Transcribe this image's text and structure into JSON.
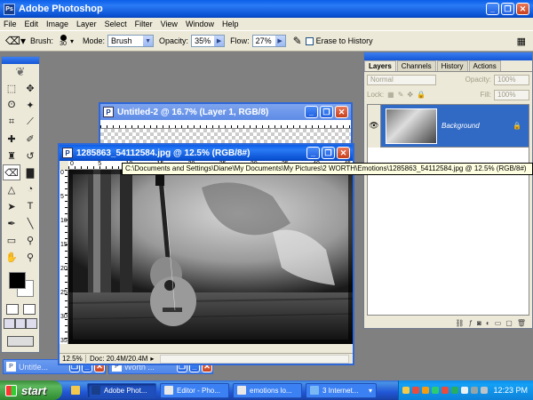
{
  "app": {
    "title": "Adobe Photoshop",
    "icon_label": "Ps"
  },
  "window_controls": {
    "minimize": "_",
    "restore": "❐",
    "close": "✕"
  },
  "menu": [
    "File",
    "Edit",
    "Image",
    "Layer",
    "Select",
    "Filter",
    "View",
    "Window",
    "Help"
  ],
  "options": {
    "brush_label": "Brush:",
    "brush_size": "30",
    "mode_label": "Mode:",
    "mode_value": "Brush",
    "opacity_label": "Opacity:",
    "opacity_value": "35%",
    "flow_label": "Flow:",
    "flow_value": "27%",
    "erase_history_label": "Erase to History"
  },
  "doc_back": {
    "title": "Untitled-2 @ 16.7% (Layer 1, RGB/8)"
  },
  "doc_front": {
    "title": "1285863_54112584.jpg @ 12.5% (RGB/8#)",
    "zoom": "12.5%",
    "doc_info": "Doc: 20.4M/20.4M",
    "ruler_h": [
      "0",
      "5",
      "10",
      "15",
      "20",
      "25",
      "30",
      "35",
      "40",
      "45"
    ],
    "ruler_v": [
      "0",
      "5",
      "10",
      "15",
      "20",
      "25",
      "30",
      "35"
    ]
  },
  "tooltip": "C:\\Documents and Settings\\Diane\\My Documents\\My Pictures\\2 WORTH\\Emotions\\1285863_54112584.jpg @ 12.5% (RGB/8#)",
  "layers_panel": {
    "tabs": [
      "Layers",
      "Channels",
      "History",
      "Actions"
    ],
    "blend_mode": "Normal",
    "opacity_label": "Opacity:",
    "opacity_value": "100%",
    "lock_label": "Lock:",
    "fill_label": "Fill:",
    "fill_value": "100%",
    "layer_name": "Background"
  },
  "minimized": [
    {
      "title": "Untitle..."
    },
    {
      "title": "Worth ..."
    }
  ],
  "taskbar": {
    "start_label": "start",
    "buttons": [
      "Adobe Phot...",
      "Editor - Pho...",
      "emotions lo...",
      "3 Internet..."
    ],
    "clock": "12:23 PM"
  },
  "colors": {
    "accent": "#316ac5",
    "xp_blue": "#0a5ee8",
    "start_green": "#3c8c3c"
  }
}
